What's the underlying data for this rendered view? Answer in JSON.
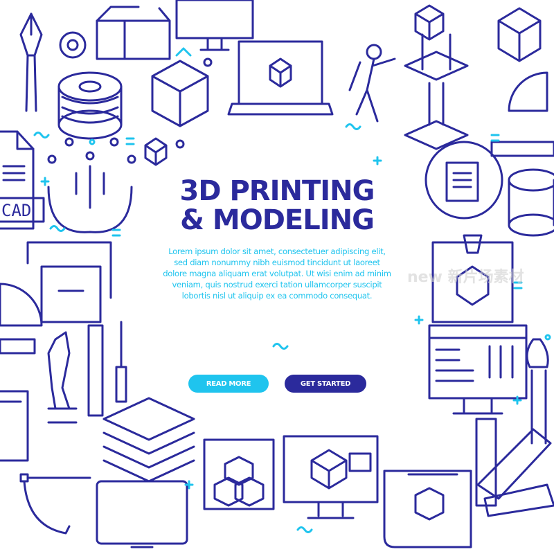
{
  "headline": {
    "line1": "3D PRINTING",
    "line2": "& MODELING"
  },
  "body_text": {
    "lines": [
      "Lorem ipsum dolor sit amet, consectetuer adipiscing elit,",
      "sed diam nonummy nibh euismod tincidunt ut laoreet",
      "dolore magna aliquam erat volutpat. Ut wisi enim ad minim",
      "veniam, quis nostrud exerci tation ullamcorper suscipit",
      "lobortis nisl ut aliquip ex ea commodo consequat."
    ]
  },
  "buttons": {
    "read_more": {
      "label": "READ MORE",
      "color": "#1fc4ee"
    },
    "get_started": {
      "label": "GET STARTED",
      "color": "#2b2a9c"
    }
  },
  "cad_label": "CAD",
  "watermark": "new 新片场素材",
  "colors": {
    "primary": "#2b2a9c",
    "accent": "#1fc4ee",
    "background": "#ffffff"
  },
  "icons": [
    "pen-nib-icon",
    "gear-icon",
    "box-icon",
    "monitor-icon",
    "filament-spool-icon",
    "cube-icon",
    "laptop-icon",
    "person-jetpack-icon",
    "printer-3d-icon",
    "protractor-icon",
    "ruler-icon",
    "cad-file-icon",
    "circuit-gear-icon",
    "document-cycle-icon",
    "wrench-icon",
    "screwdriver-icon",
    "layers-icon",
    "cube-stack-icon",
    "tablet-icon",
    "settings-monitor-icon",
    "paintbrush-icon",
    "color-swatch-icon",
    "blueprint-icon",
    "bezier-icon"
  ]
}
